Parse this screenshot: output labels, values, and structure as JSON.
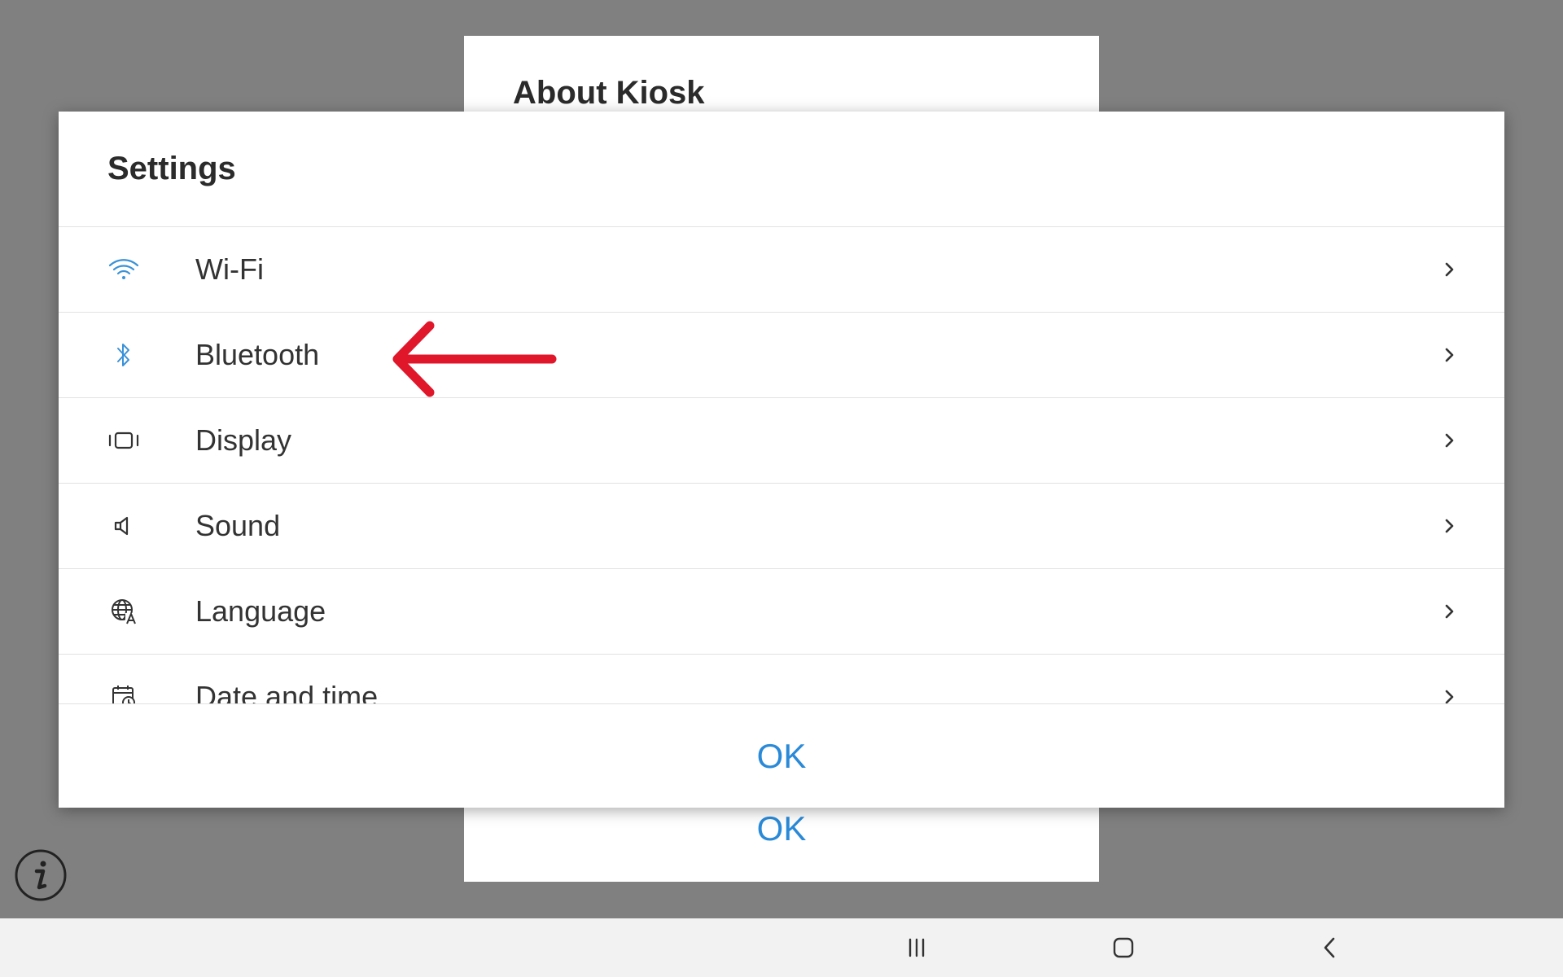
{
  "about_dialog": {
    "title": "About Kiosk",
    "ok_label": "OK"
  },
  "settings_dialog": {
    "title": "Settings",
    "items": [
      {
        "label": "Wi-Fi",
        "icon": "wifi-icon"
      },
      {
        "label": "Bluetooth",
        "icon": "bluetooth-icon"
      },
      {
        "label": "Display",
        "icon": "display-icon"
      },
      {
        "label": "Sound",
        "icon": "speaker-icon"
      },
      {
        "label": "Language",
        "icon": "language-icon"
      },
      {
        "label": "Date and time",
        "icon": "calendar-clock-icon"
      }
    ],
    "ok_label": "OK"
  },
  "annotation": {
    "icon": "red-arrow-icon",
    "color": "#e0172b"
  },
  "info_button": {
    "icon": "info-icon"
  },
  "nav_bar": {
    "buttons": [
      "recents-icon",
      "home-icon",
      "back-icon"
    ]
  },
  "colors": {
    "accent": "#2a8ad8",
    "scrim": "#808080",
    "icon_blue": "#3a92d8",
    "text": "#333333"
  }
}
